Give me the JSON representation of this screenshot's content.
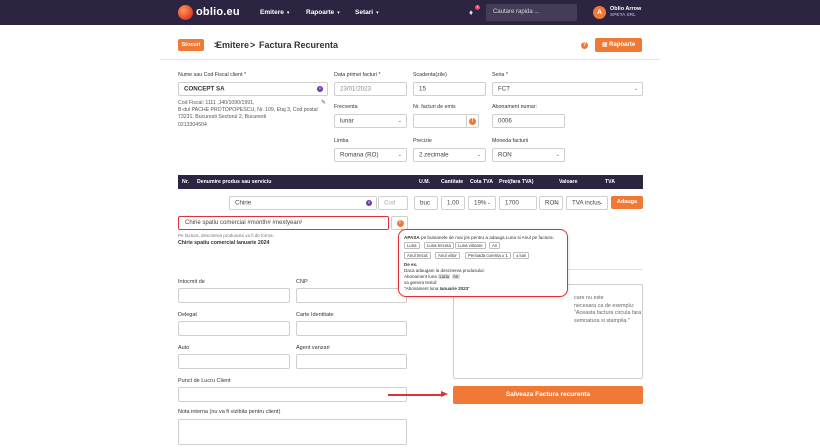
{
  "nav": {
    "brand": "oblio.eu",
    "items": [
      {
        "label": "Emitere"
      },
      {
        "label": "Rapoarte"
      },
      {
        "label": "Setari"
      }
    ],
    "notifications_count": "1",
    "search_placeholder": "Cautare rapida ...",
    "user": {
      "initial": "A",
      "name": "Oblio Arrow",
      "company": "SPETA SRL"
    }
  },
  "header": {
    "stocuri_label": "Stocuri",
    "crumb_1": "Emitere",
    "crumb_sep": ">",
    "crumb_2": "Factura Recurenta",
    "help": "?",
    "rapoarte_label": "Rapoarte"
  },
  "client": {
    "label": "Nume sau Cod Fiscal client *",
    "value": "CONCEPT SA",
    "info_lines": [
      "Cod Fiscal: 1111 ,J40/1090/1991,",
      "B-dul PACHE PROTOPOPESCU, Nr. 109, Etaj 3, Cod postal",
      "73231, Bucuresti Sectorul 2, Bucuresti",
      "0213304504"
    ]
  },
  "invoice": {
    "date_label": "Data primei facturi *",
    "date_value": "23/01/2023",
    "due_label": "Scadenta(zile)",
    "due_value": "15",
    "series_label": "Seria *",
    "series_value": "FCT",
    "freq_label": "Frecventa",
    "freq_value": "lunar",
    "count_label": "Nr. facturi de emis",
    "count_value": "",
    "sub_label": "Abonament numar:",
    "sub_value": "0006",
    "lang_label": "Limba",
    "lang_value": "Romana (RO)",
    "precision_label": "Precizie",
    "precision_value": "2 zecimale",
    "currency_label": "Moneda facturii",
    "currency_value": "RON"
  },
  "table": {
    "headers": [
      "Nr.",
      "Denumire produs sau serviciu",
      "U.M.",
      "Cantitate",
      "Cota TVA",
      "Pret(fara TVA)",
      "Valoare",
      "TVA"
    ],
    "row": {
      "name": "Chirie",
      "code_placeholder": "Cod",
      "um": "buc",
      "qty": "1.00",
      "vat": "19%",
      "price": "1700",
      "currency": "RON",
      "vat_mode": "TVA inclus"
    },
    "add_label": "Adauga",
    "description": "Chirie spatiu comercial #month# #nextyear#",
    "description_note": "Pe factura, descrierea produsului va fi de forma:",
    "description_example": "Chirie spatiu comercial Ianuarie 2024"
  },
  "popup": {
    "title_bold": "APASA",
    "title_rest": "pe butoanele de mai jos pentru a adauga Luna si Anul pe factura:",
    "chips_row1": [
      "Luna",
      "Luna trecuta",
      "Luna viitoare",
      "An"
    ],
    "chips_row2": [
      "Anul trecut",
      "Anul viitor",
      "Perioada curenta ± 1",
      "± luni"
    ],
    "ex_title": "De ex.",
    "ex_line1": "Daca adaugam la descrierea produsului:",
    "ex_line2_pre": "Abonament luna",
    "ex_chip1": "Luna",
    "ex_chip2": "An",
    "ex_line3": "va genera textul:",
    "ex_line4_pre": "\"Abonament luna",
    "ex_line4_bold": "Ianuarie 2023",
    "ex_line4_post": "\""
  },
  "form": {
    "intocmit_label": "Intocmit de",
    "cnp_label": "CNP",
    "delegat_label": "Delegat",
    "carte_label": "Carte Identitate",
    "auto_label": "Auto",
    "agent_label": "Agent vanzari",
    "punct_label": "Punct de Lucru Client",
    "nota_label": "Nota interna (nu va fi vizibila pentru client)"
  },
  "mentions": {
    "text_1": "care nu este",
    "text_2": "necesara ca de exemplu:",
    "text_3": "\"Aceasta factura circula fara semnatura si stampila.\""
  },
  "save_label": "Salveaza Factura recurenta",
  "colors": {
    "accent": "#f07a35",
    "nav_bg": "#2c2440",
    "highlight": "#e0303a"
  }
}
